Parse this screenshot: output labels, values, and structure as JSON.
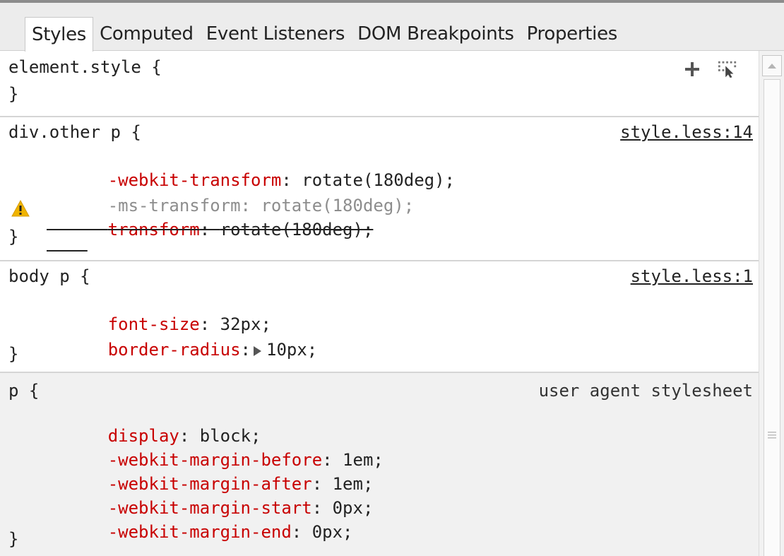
{
  "tabs": [
    {
      "label": "Styles",
      "selected": true
    },
    {
      "label": "Computed",
      "selected": false
    },
    {
      "label": "Event Listeners",
      "selected": false
    },
    {
      "label": "DOM Breakpoints",
      "selected": false
    },
    {
      "label": "Properties",
      "selected": false
    }
  ],
  "toolbar": {
    "add_icon": "plus-icon",
    "select_icon": "element-state-icon"
  },
  "rules": [
    {
      "selector_line": "element.style {",
      "close": "}",
      "source": "",
      "properties": []
    },
    {
      "selector_line": "div.other p {",
      "close": "}",
      "source": "style.less:14",
      "properties": [
        {
          "name": "-webkit-transform",
          "value": "rotate(180deg);",
          "state": "active"
        },
        {
          "name": "-ms-transform",
          "value": "rotate(180deg);",
          "state": "inactive"
        },
        {
          "name": "transform",
          "value": "rotate(180deg);",
          "state": "overridden-warning"
        }
      ]
    },
    {
      "selector_line": "body p {",
      "close": "}",
      "source": "style.less:1",
      "properties": [
        {
          "name": "font-size",
          "value": "32px;",
          "state": "active"
        },
        {
          "name": "border-radius",
          "value": "10px;",
          "state": "expandable"
        }
      ]
    },
    {
      "selector_line": "p {",
      "close": "}",
      "source": "user agent stylesheet",
      "properties": [
        {
          "name": "display",
          "value": "block;",
          "state": "active"
        },
        {
          "name": "-webkit-margin-before",
          "value": "1em;",
          "state": "active"
        },
        {
          "name": "-webkit-margin-after",
          "value": "1em;",
          "state": "active"
        },
        {
          "name": "-webkit-margin-start",
          "value": "0px;",
          "state": "active"
        },
        {
          "name": "-webkit-margin-end",
          "value": "0px;",
          "state": "active"
        }
      ]
    }
  ],
  "colors": {
    "property_name": "#c80000",
    "inactive": "#8d8d8d",
    "warning": "#f0b400"
  }
}
